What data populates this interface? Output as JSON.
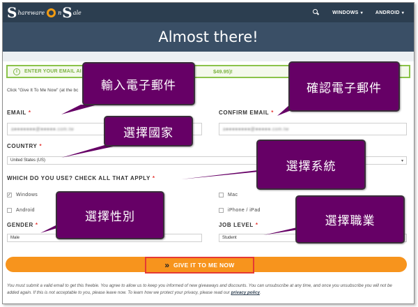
{
  "site": {
    "logo_initial_left": "S",
    "logo_word_left": "hareware",
    "logo_word_right": "n",
    "logo_initial_right": "S",
    "logo_end": "ale",
    "nav": [
      {
        "label": "WINDOWS",
        "chevron": "▾"
      },
      {
        "label": "ANDROID",
        "chevron": "▾"
      }
    ]
  },
  "hero": {
    "title": "Almost there!"
  },
  "alert": {
    "icon": "i",
    "text": "ENTER YOUR EMAIL AI",
    "price": "$49.95)!"
  },
  "form": {
    "intro": "Click \"Give It To Me Now\" (at the bc",
    "required_mark": "*",
    "email": {
      "label": "EMAIL",
      "value": "a●●●●●●●@●●●●●.com.tw"
    },
    "confirm_email": {
      "label": "CONFIRM EMAIL",
      "value": "a●●●●●●●●@●●●●●.com.tw"
    },
    "country": {
      "label": "COUNTRY",
      "value": "United States (US)",
      "arrow": "▾"
    },
    "os_question": "WHICH DO YOU USE? CHECK ALL THAT APPLY",
    "os_options": [
      {
        "label": "Windows",
        "checked": true,
        "mark": "✓"
      },
      {
        "label": "Mac",
        "checked": false,
        "mark": ""
      },
      {
        "label": "Android",
        "checked": false,
        "mark": ""
      },
      {
        "label": "iPhone / iPad",
        "checked": false,
        "mark": ""
      }
    ],
    "gender": {
      "label": "GENDER",
      "value": "Male"
    },
    "job_level": {
      "label": "JOB LEVEL",
      "value": "Student"
    },
    "submit": {
      "icon": "»",
      "label": "GIVE IT TO ME NOW"
    }
  },
  "disclaimer": {
    "text": "You must submit a valid email to get this freebie. You agree to allow us to keep you informed of new giveaways and discounts. You can unsubscribe at any time, and once you unsubscribe you will not be added again. If this is not acceptable to you, please leave now. To learn how we protect your privacy, please read our",
    "link": "privacy policy",
    "end": "."
  },
  "callouts": {
    "email": "輸入電子郵件",
    "confirm": "確認電子郵件",
    "country": "選擇國家",
    "os": "選擇系統",
    "gender": "選擇性別",
    "job": "選擇職業",
    "fill": "#660066"
  }
}
